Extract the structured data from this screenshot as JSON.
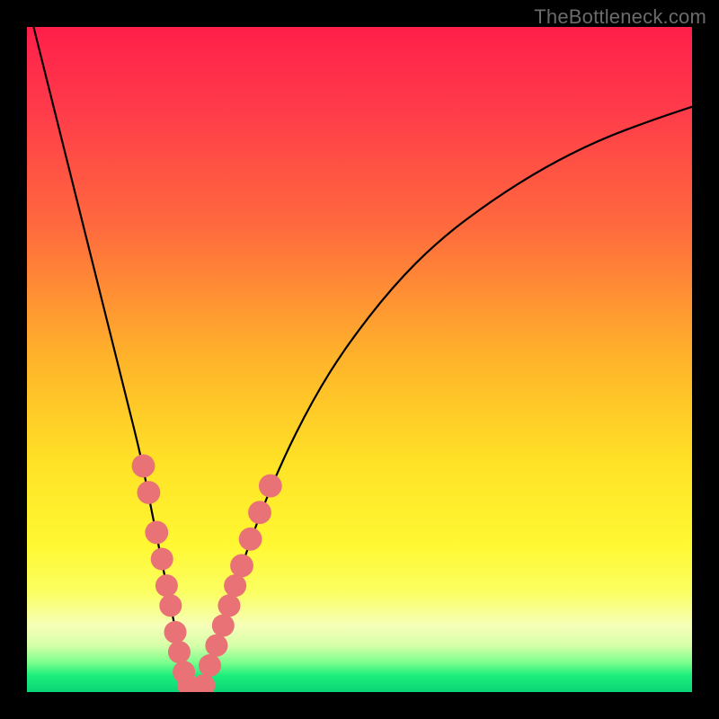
{
  "watermark": "TheBottleneck.com",
  "colors": {
    "frame": "#000000",
    "curve": "#000000",
    "marker": "#e97277",
    "gradient_stops": [
      {
        "offset": 0.0,
        "color": "#ff1f4a"
      },
      {
        "offset": 0.12,
        "color": "#ff3a4a"
      },
      {
        "offset": 0.3,
        "color": "#ff6a3e"
      },
      {
        "offset": 0.5,
        "color": "#ffb42a"
      },
      {
        "offset": 0.66,
        "color": "#ffe326"
      },
      {
        "offset": 0.78,
        "color": "#fff833"
      },
      {
        "offset": 0.85,
        "color": "#fbff62"
      },
      {
        "offset": 0.9,
        "color": "#f6ffb8"
      },
      {
        "offset": 0.93,
        "color": "#d6ffa8"
      },
      {
        "offset": 0.955,
        "color": "#7dff8e"
      },
      {
        "offset": 0.975,
        "color": "#1dee7c"
      },
      {
        "offset": 1.0,
        "color": "#0ad577"
      }
    ]
  },
  "chart_data": {
    "type": "line",
    "title": "",
    "xlabel": "",
    "ylabel": "",
    "xlim": [
      0,
      100
    ],
    "ylim": [
      0,
      100
    ],
    "grid": false,
    "legend": false,
    "series": [
      {
        "name": "bottleneck-curve",
        "x": [
          1,
          3,
          5,
          7,
          9,
          11,
          13,
          15,
          17,
          18,
          19,
          20,
          21,
          22,
          23,
          24,
          25,
          27,
          29,
          31,
          34,
          38,
          43,
          48,
          55,
          62,
          70,
          78,
          86,
          94,
          100
        ],
        "y": [
          100,
          92,
          84,
          76,
          68,
          60,
          52,
          44,
          36,
          31,
          26,
          21,
          16,
          11,
          6,
          2,
          0,
          2,
          8,
          15,
          24,
          34,
          44,
          52,
          61,
          68,
          74,
          79,
          83,
          86,
          88
        ]
      }
    ],
    "markers": [
      {
        "x": 17.5,
        "y": 34,
        "r": 1.7
      },
      {
        "x": 18.3,
        "y": 30,
        "r": 1.7
      },
      {
        "x": 19.5,
        "y": 24,
        "r": 1.7
      },
      {
        "x": 20.3,
        "y": 20,
        "r": 1.6
      },
      {
        "x": 21.0,
        "y": 16,
        "r": 1.6
      },
      {
        "x": 21.6,
        "y": 13,
        "r": 1.6
      },
      {
        "x": 22.3,
        "y": 9,
        "r": 1.6
      },
      {
        "x": 22.9,
        "y": 6,
        "r": 1.6
      },
      {
        "x": 23.6,
        "y": 3,
        "r": 1.6
      },
      {
        "x": 24.3,
        "y": 1,
        "r": 1.6
      },
      {
        "x": 25.0,
        "y": 0,
        "r": 1.6
      },
      {
        "x": 25.8,
        "y": 0,
        "r": 1.6
      },
      {
        "x": 26.6,
        "y": 1,
        "r": 1.6
      },
      {
        "x": 27.5,
        "y": 4,
        "r": 1.6
      },
      {
        "x": 28.5,
        "y": 7,
        "r": 1.6
      },
      {
        "x": 29.5,
        "y": 10,
        "r": 1.6
      },
      {
        "x": 30.4,
        "y": 13,
        "r": 1.6
      },
      {
        "x": 31.3,
        "y": 16,
        "r": 1.6
      },
      {
        "x": 32.3,
        "y": 19,
        "r": 1.7
      },
      {
        "x": 33.6,
        "y": 23,
        "r": 1.7
      },
      {
        "x": 35.0,
        "y": 27,
        "r": 1.7
      },
      {
        "x": 36.6,
        "y": 31,
        "r": 1.7
      }
    ]
  }
}
